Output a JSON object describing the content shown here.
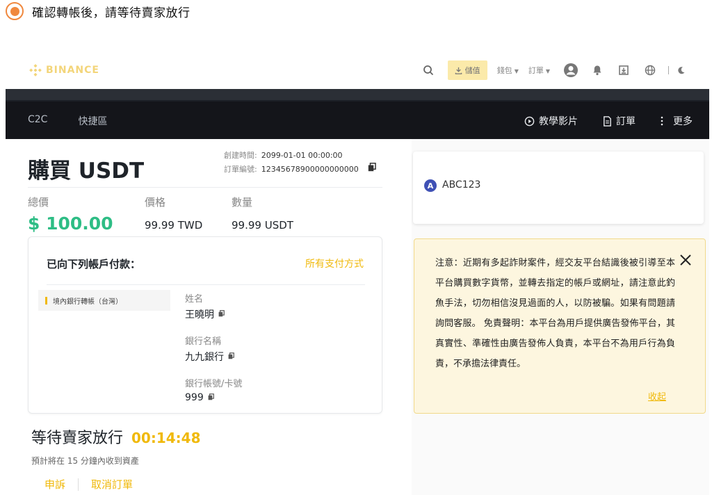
{
  "step": {
    "text": "確認轉帳後，請等待賣家放行"
  },
  "header": {
    "logo_text": "BINANCE",
    "deposit_label": "儲值",
    "wallet_label": "錢包",
    "orders_label": "訂單"
  },
  "nav": {
    "left_items": [
      "C2C",
      "快捷區"
    ],
    "tutorial_label": "教學影片",
    "orders_label": "訂單",
    "more_label": "更多"
  },
  "order": {
    "title": "購買 USDT",
    "created_label": "創建時間:",
    "created_value": "2099-01-01 00:00:00",
    "order_no_label": "訂單編號:",
    "order_no_value": "12345678900000000000",
    "total_label": "總價",
    "total_value": "$ 100.00",
    "price_label": "價格",
    "price_value": "99.99 TWD",
    "qty_label": "數量",
    "qty_value": "99.99 USDT"
  },
  "payment": {
    "heading": "已向下列帳戶付款：",
    "all_methods": "所有支付方式",
    "method": "境內銀行轉帳（台灣）",
    "name_label": "姓名",
    "name_value": "王曉明",
    "bank_label": "銀行名稱",
    "bank_value": "九九銀行",
    "account_label": "銀行帳號/卡號",
    "account_value": "999"
  },
  "status": {
    "waiting": "等待賣家放行",
    "timer": "00:14:48",
    "eta": "預計將在 15 分鐘內收到資產",
    "appeal": "申訴",
    "cancel": "取消訂單"
  },
  "seller": {
    "avatar_letter": "A",
    "name": "ABC123"
  },
  "notice": {
    "text": "注意：近期有多起詐財案件，經交友平台結識後被引導至本平台購買數字貨幣，並轉去指定的帳戶或網址，請注意此釣魚手法，切勿相信沒見過面的人，以防被騙。如果有問題請詢問客服。 免責聲明：本平台為用戶提供廣告發佈平台，其真實性、準確性由廣告發佈人負責，本平台不為用戶行為負責，不承擔法律責任。",
    "collapse_label": "收起"
  },
  "colors": {
    "accent": "#f0b90b",
    "total_green": "#2ebd85",
    "step_orange": "#f0883e",
    "nav_bg": "#14151a"
  }
}
